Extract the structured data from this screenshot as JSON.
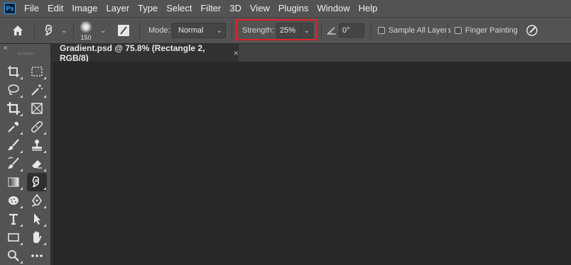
{
  "app": {
    "logo_text": "Ps"
  },
  "menu": [
    "File",
    "Edit",
    "Image",
    "Layer",
    "Type",
    "Select",
    "Filter",
    "3D",
    "View",
    "Plugins",
    "Window",
    "Help"
  ],
  "options": {
    "brush_size": "150",
    "mode_label": "Mode:",
    "mode_value": "Normal",
    "strength_label": "Strength:",
    "strength_value": "25%",
    "angle_value": "0°",
    "sample_all_layers": "Sample All Layers",
    "finger_painting": "Finger Painting",
    "highlight_color": "#e1202a"
  },
  "toolbar": {
    "collapse_glyph": "«"
  },
  "document": {
    "tab_title": "Gradient.psd @ 75.8% (Rectangle 2, RGB/8)",
    "close_glyph": "×"
  }
}
